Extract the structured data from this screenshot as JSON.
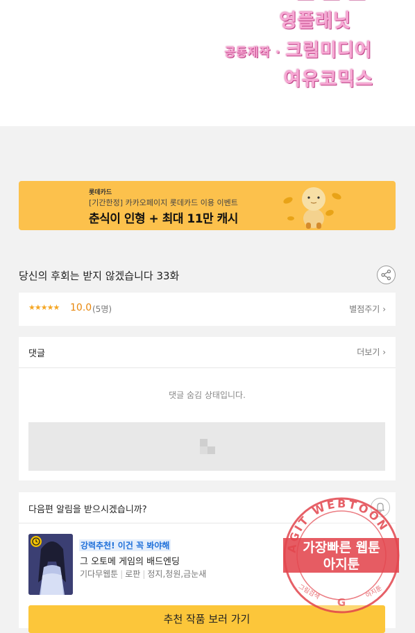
{
  "credits": {
    "line0": "— — —",
    "line1": "영플래닛",
    "line2_prefix": "공동제작 · ",
    "line2": "크림미디어",
    "line3": "여유코믹스"
  },
  "banner": {
    "brand": "롯데카드",
    "subtitle": "[기간한정] 카카오페이지 롯데카드 이용 이벤트",
    "headline": "춘식이 인형 + 최대 11만 캐시"
  },
  "episode": {
    "title": "당신의 후회는 받지 않겠습니다 33화"
  },
  "rating": {
    "stars": "★★★★★",
    "score": "10.0",
    "count": "(5명)",
    "rate_label": "별점주기"
  },
  "comments": {
    "title": "댓글",
    "more_label": "더보기",
    "hidden_message": "댓글 숨김 상태입니다."
  },
  "notify": {
    "question": "다음편 알림을 받으시겠습니까?",
    "promo_label": "강력추천! 이건 꼭 봐야해",
    "work_title": "그 오토메 게임의 배드엔딩",
    "genre1": "기다무웹툰",
    "genre2": "로판",
    "authors": "정지,청원,금눈새",
    "cta_label": "추천 작품 보러 가기"
  },
  "stamp": {
    "ring_text": "AGIT WEBTOON",
    "line1": "가장빠른 웹툰",
    "line2": "아지툰",
    "bottom_left": "그림검색",
    "bottom_right": "아지툰"
  },
  "colors": {
    "banner_bg": "#fcc14c",
    "accent_yellow": "#fcc63a",
    "promo_blue": "#1e6fd9",
    "score_orange": "#e8860a",
    "stamp_red": "#e2454d"
  }
}
